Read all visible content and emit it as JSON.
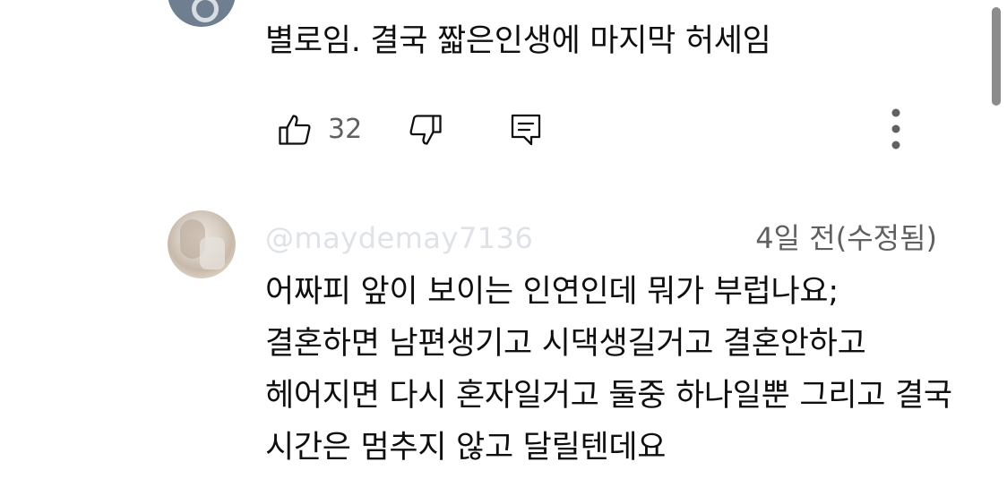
{
  "comments": [
    {
      "text": "별로임. 결국 짧은인생에 마지막 허세임",
      "likes": "32"
    },
    {
      "username": "@maydemay7136",
      "timestamp": "4일 전(수정됨)",
      "text": "어짜피 앞이 보이는 인연인데 뭐가 부럽나요; 결혼하면 남편생기고 시댁생길거고 결혼안하고 헤어지면 다시 혼자일거고 둘중 하나일뿐 그리고 결국 시간은 멈추지 않고 달릴텐데요"
    }
  ],
  "icons": {
    "like": "thumbs-up-icon",
    "dislike": "thumbs-down-icon",
    "reply": "reply-comment-icon",
    "more": "more-vertical-icon"
  },
  "colors": {
    "text": "#0f0f0f",
    "secondary": "#606060",
    "username_faded": "#dfe3e7",
    "scrollbar": "#8c8c8c"
  }
}
